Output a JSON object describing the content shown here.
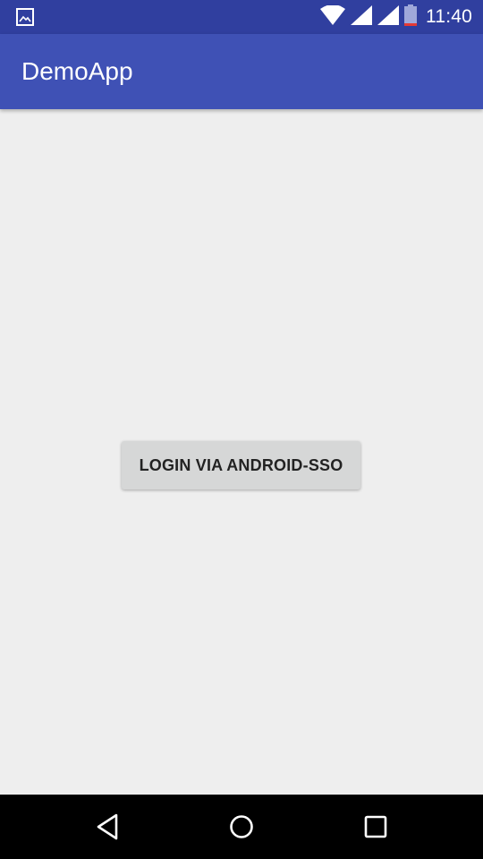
{
  "status_bar": {
    "time": "11:40",
    "icons": [
      "image-notification-icon",
      "wifi-icon",
      "signal-icon",
      "signal-icon",
      "battery-icon"
    ],
    "background_color": "#303f9f"
  },
  "app_bar": {
    "title": "DemoApp",
    "background_color": "#3f51b5"
  },
  "main": {
    "login_button_label": "LOGIN VIA ANDROID-SSO",
    "background_color": "#eeeeee"
  },
  "nav_bar": {
    "buttons": [
      "back-icon",
      "home-icon",
      "recents-icon"
    ]
  }
}
